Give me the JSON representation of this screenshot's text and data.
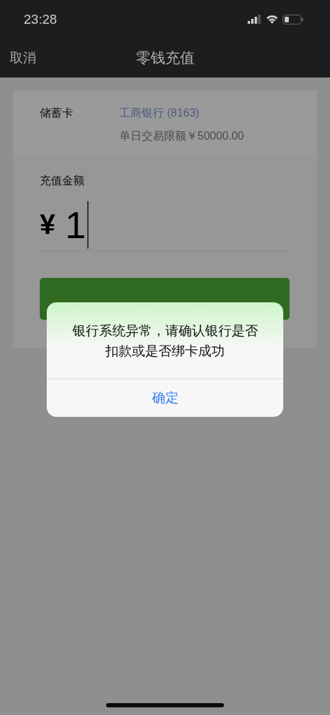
{
  "status_bar": {
    "time": "23:28"
  },
  "nav_bar": {
    "cancel": "取消",
    "title": "零钱充值"
  },
  "card": {
    "label": "储蓄卡",
    "bank": "工商银行 (8163)",
    "limit": "单日交易限额￥50000.00"
  },
  "amount": {
    "label": "充值金额",
    "currency": "¥",
    "value": "1"
  },
  "dialog": {
    "message": "银行系统异常，请确认银行是否扣款或是否绑卡成功",
    "button": "确定"
  }
}
